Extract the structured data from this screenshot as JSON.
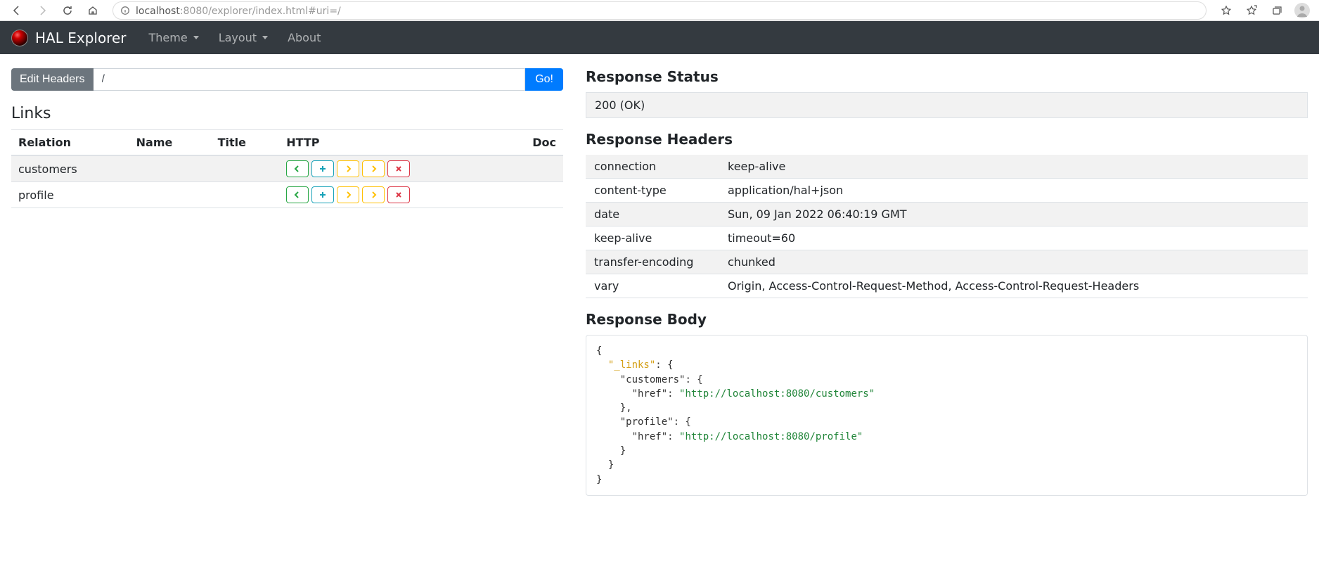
{
  "browser": {
    "url_host": "localhost",
    "url_rest": ":8080/explorer/index.html#uri=/"
  },
  "app": {
    "brand": "HAL Explorer",
    "nav": {
      "theme": "Theme",
      "layout": "Layout",
      "about": "About"
    }
  },
  "uribar": {
    "edit_headers": "Edit Headers",
    "uri_value": "/",
    "go": "Go!"
  },
  "links": {
    "heading": "Links",
    "cols": {
      "relation": "Relation",
      "name": "Name",
      "title": "Title",
      "http": "HTTP",
      "doc": "Doc"
    },
    "rows": [
      {
        "relation": "customers",
        "name": "",
        "title": ""
      },
      {
        "relation": "profile",
        "name": "",
        "title": ""
      }
    ]
  },
  "response": {
    "status_heading": "Response Status",
    "status_text": "200 (OK)",
    "headers_heading": "Response Headers",
    "headers": [
      {
        "k": "connection",
        "v": "keep-alive"
      },
      {
        "k": "content-type",
        "v": "application/hal+json"
      },
      {
        "k": "date",
        "v": "Sun, 09 Jan 2022 06:40:19 GMT"
      },
      {
        "k": "keep-alive",
        "v": "timeout=60"
      },
      {
        "k": "transfer-encoding",
        "v": "chunked"
      },
      {
        "k": "vary",
        "v": "Origin, Access-Control-Request-Method, Access-Control-Request-Headers"
      }
    ],
    "body_heading": "Response Body",
    "body": {
      "links_key": "\"_links\"",
      "customers_key": "\"customers\"",
      "profile_key": "\"profile\"",
      "href_key": "\"href\"",
      "customers_url": "\"http://localhost:8080/customers\"",
      "profile_url": "\"http://localhost:8080/profile\""
    }
  }
}
